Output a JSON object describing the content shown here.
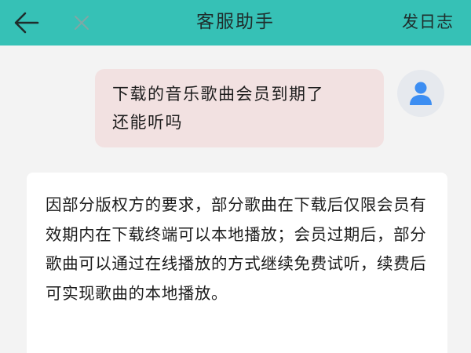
{
  "header": {
    "title": "客服助手",
    "action_label": "发日志"
  },
  "colors": {
    "header_bg": "#36c1b6",
    "user_bubble_bg": "#f2e1e1",
    "bot_bubble_bg": "#ffffff",
    "avatar_icon": "#3d8ef2"
  },
  "icons": {
    "back": "back-arrow-icon",
    "close": "close-icon",
    "avatar": "user-icon"
  },
  "messages": {
    "user": {
      "line1": "下载的音乐歌曲会员到期了",
      "line2": "还能听吗"
    },
    "bot": {
      "text": "因部分版权方的要求，部分歌曲在下载后仅限会员有效期内在下载终端可以本地播放；会员过期后，部分歌曲可以通过在线播放的方式继续免费试听，续费后可实现歌曲的本地播放。"
    }
  }
}
